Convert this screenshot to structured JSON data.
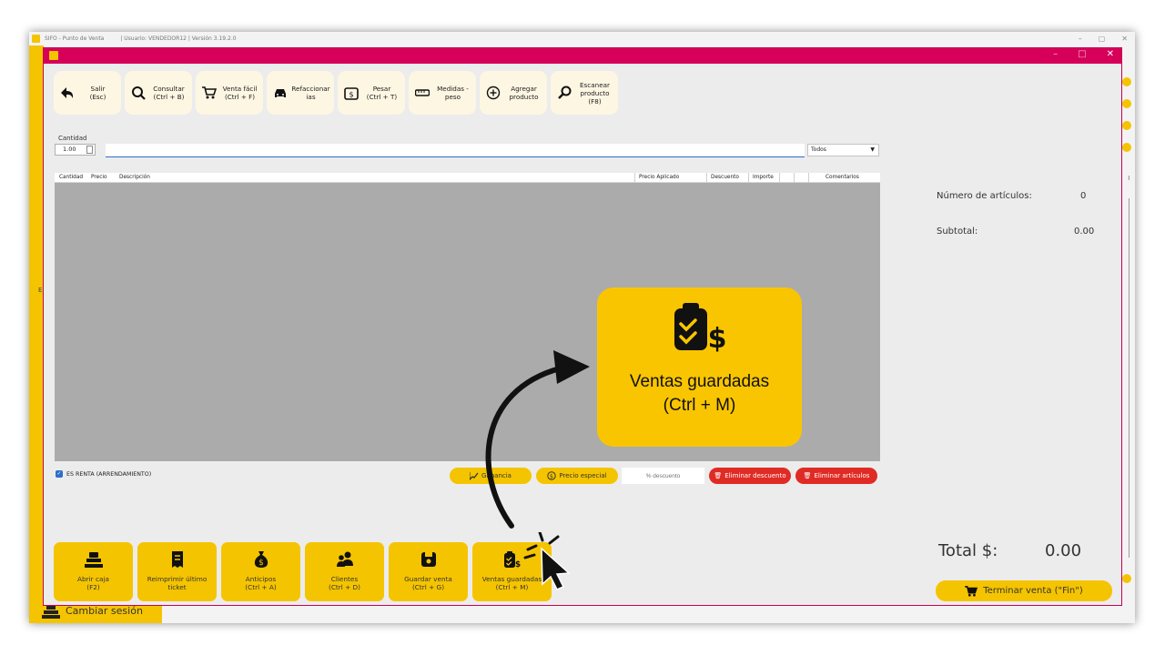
{
  "outer_window": {
    "title": "SIFO - Punto de Venta",
    "user_version": "| Usuario: VENDEDOR12 | Versión 3.19.2.0",
    "switch_session_label": "Cambiar sesión",
    "side_letter": "E",
    "right_letter": "l"
  },
  "inner_window": {
    "controls": [
      "–",
      "□",
      "✕"
    ]
  },
  "toolbar": {
    "items": [
      {
        "label": "Salir\n(Esc)",
        "icon": "back-arrow-icon"
      },
      {
        "label": "Consultar\n(Ctrl + B)",
        "icon": "search-icon"
      },
      {
        "label": "Venta fácil\n(Ctrl + F)",
        "icon": "cart-icon"
      },
      {
        "label": "Refaccionar\nias",
        "icon": "car-icon"
      },
      {
        "label": "Pesar\n(Ctrl + T)",
        "icon": "scale-icon"
      },
      {
        "label": "Medidas -\npeso",
        "icon": "ruler-icon"
      },
      {
        "label": "Agregar\nproducto",
        "icon": "plus-circle-icon"
      },
      {
        "label": "Escanear\nproducto\n(F8)",
        "icon": "scan-icon"
      }
    ]
  },
  "quantity": {
    "label": "Cantidad",
    "value": "1.00"
  },
  "search": {
    "value": ""
  },
  "filter": {
    "selected": "Todos"
  },
  "grid": {
    "columns": [
      "Cantidad",
      "Precio",
      "Descripción",
      "Precio Aplicado",
      "Descuento",
      "Importe",
      "Comentarios"
    ]
  },
  "options": {
    "renta_label": "ES RENTA (ARRENDAMIENTO)",
    "ganancia_label": "Ganancia",
    "precio_especial_label": "Precio especial",
    "descuento_placeholder": "% descuento",
    "eliminar_descuento_label": "Eliminar descuento",
    "eliminar_articulos_label": "Eliminar artículos"
  },
  "summary": {
    "items_label": "Número de artículos:",
    "items_value": "0",
    "subtotal_label": "Subtotal:",
    "subtotal_value": "0.00",
    "total_label": "Total $:",
    "total_value": "0.00",
    "finish_label": "Terminar venta (\"Fin\")"
  },
  "bottom_buttons": [
    {
      "label": "Abrir caja\n(F2)",
      "icon": "cash-register-icon"
    },
    {
      "label": "Reimprimir último\nticket",
      "icon": "receipt-icon"
    },
    {
      "label": "Anticipos\n(Ctrl + A)",
      "icon": "money-bag-icon"
    },
    {
      "label": "Clientes\n(Ctrl + D)",
      "icon": "users-icon"
    },
    {
      "label": "Guardar venta\n(Ctrl + G)",
      "icon": "save-icon"
    },
    {
      "label": "Ventas guardadas\n(Ctrl + M)",
      "icon": "saved-sales-icon"
    }
  ],
  "callout": {
    "label": "Ventas guardadas\n(Ctrl + M)",
    "icon": "saved-sales-icon"
  },
  "colors": {
    "accent": "#f5c400",
    "titlebar": "#d6005a",
    "danger": "#e02b24",
    "grid": "#ababab"
  }
}
